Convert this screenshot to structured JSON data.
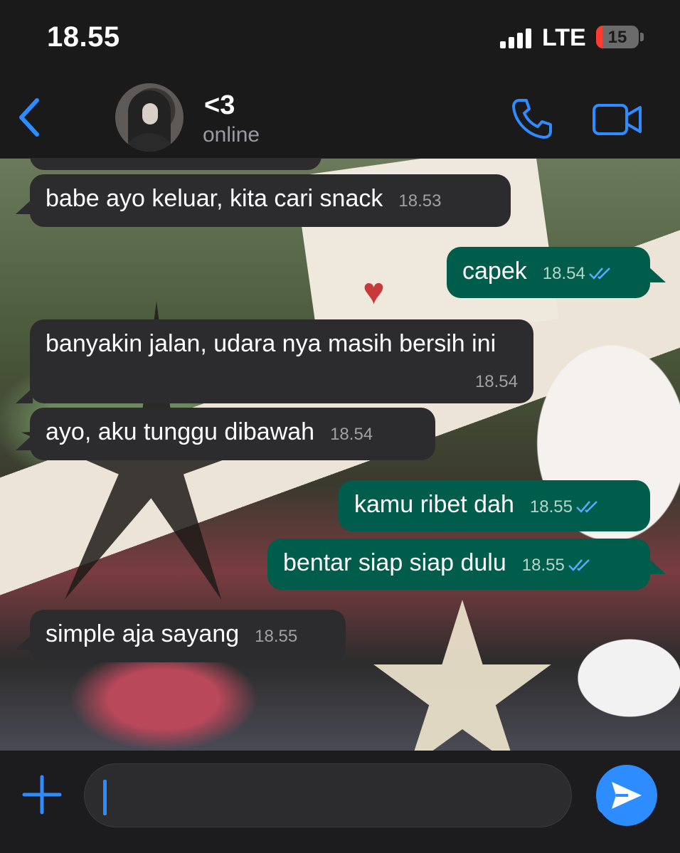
{
  "status_bar": {
    "time": "18.55",
    "network": "LTE",
    "battery_level": "15",
    "battery_fraction": 0.15,
    "signal_icon": "signal-bars-icon",
    "battery_color": "#ff3b30"
  },
  "header": {
    "contact_name": "<3",
    "contact_status": "online",
    "accent_color": "#2d8cff"
  },
  "messages": [
    {
      "direction": "in",
      "text": "babe ayo keluar, kita cari snack",
      "time": "18.53"
    },
    {
      "direction": "out",
      "text": "capek",
      "time": "18.54",
      "status": "read"
    },
    {
      "direction": "in",
      "text": "banyakin jalan, udara nya masih bersih ini",
      "time": "18.54"
    },
    {
      "direction": "in",
      "text": "ayo, aku tunggu dibawah",
      "time": "18.54"
    },
    {
      "direction": "out",
      "text": "kamu ribet dah",
      "time": "18.55",
      "status": "read"
    },
    {
      "direction": "out",
      "text": "bentar siap siap dulu",
      "time": "18.55",
      "status": "read"
    },
    {
      "direction": "in",
      "text": "simple aja sayang",
      "time": "18.55"
    }
  ],
  "input": {
    "placeholder": "",
    "value": ""
  },
  "colors": {
    "incoming_bubble": "#2c2c2e",
    "outgoing_bubble": "#005c4b",
    "background": "#1c1c1e"
  }
}
